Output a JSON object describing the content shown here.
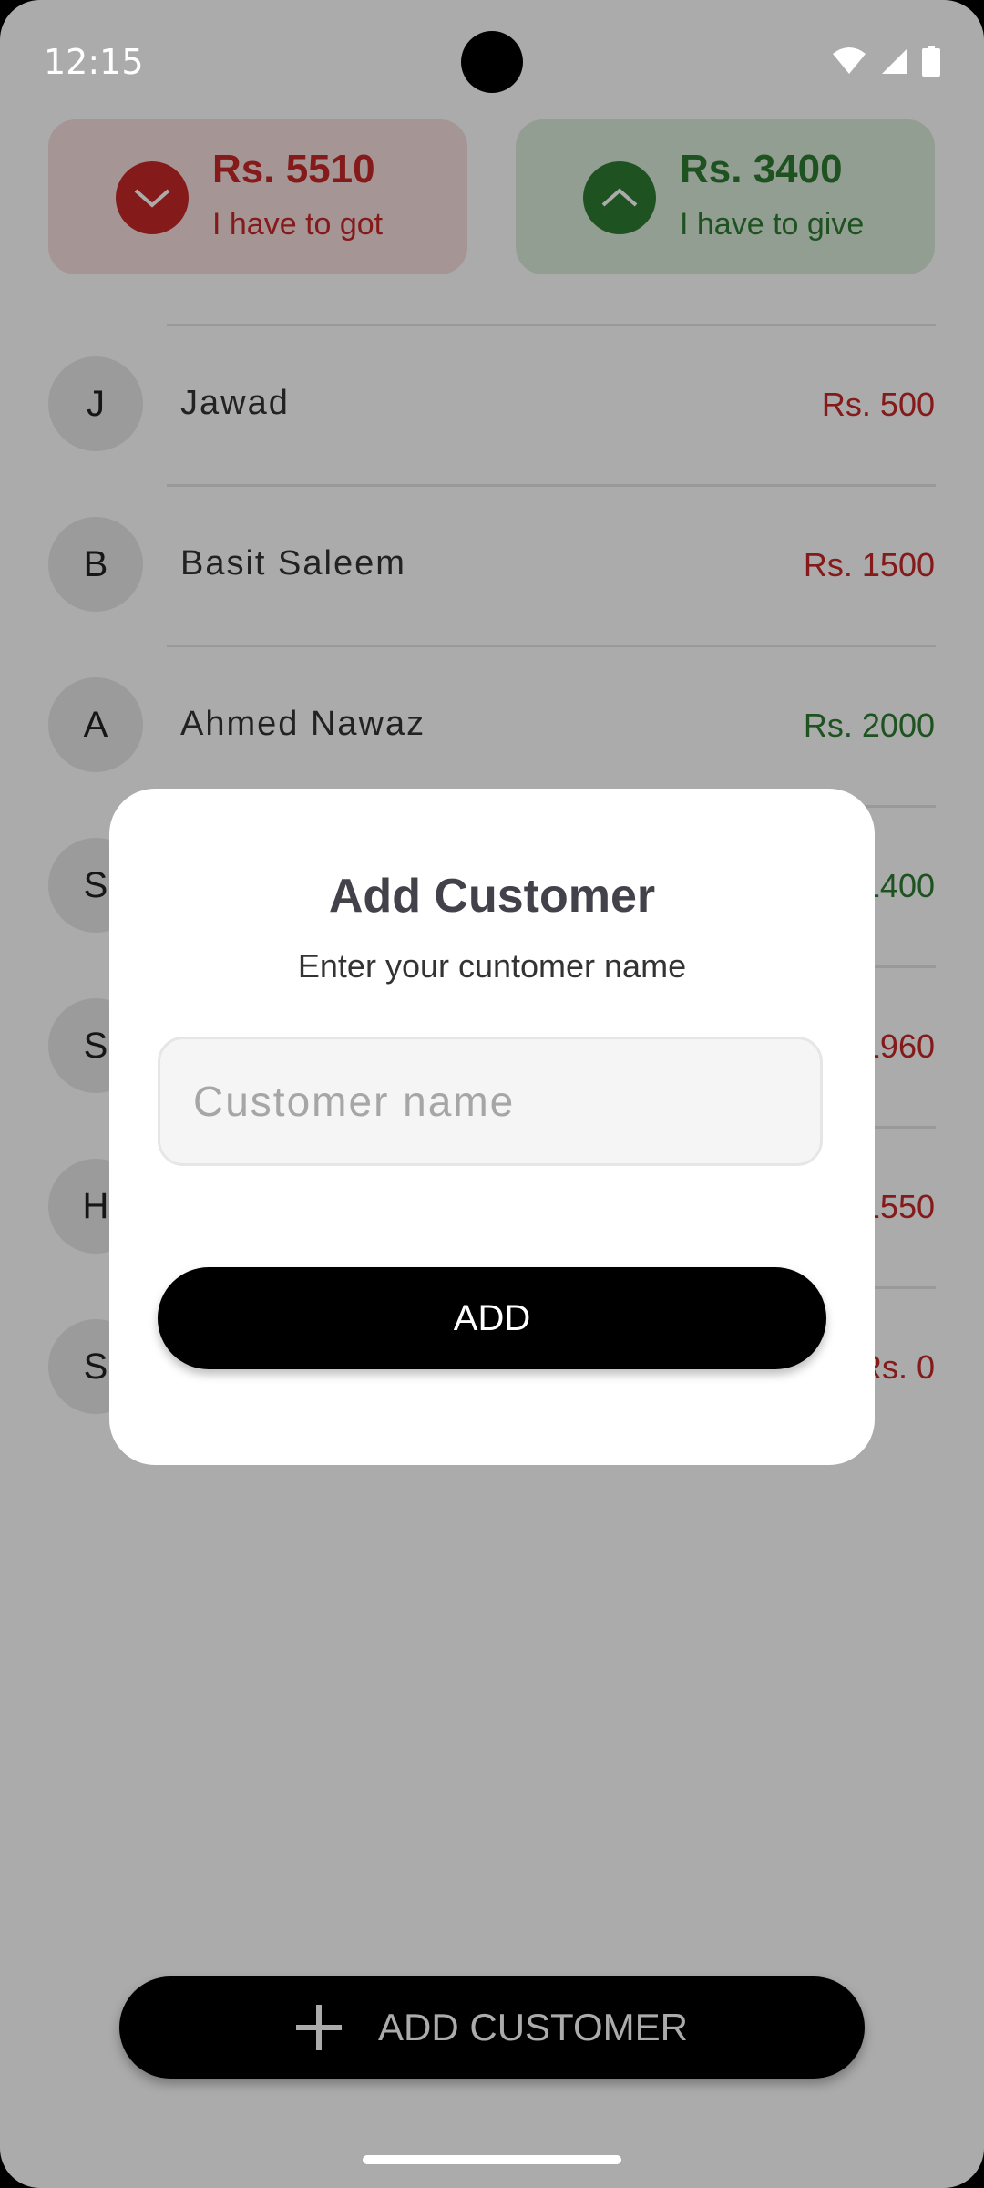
{
  "status_bar": {
    "time": "12:15"
  },
  "summary": {
    "got": {
      "amount": "Rs. 5510",
      "label": "I have to got",
      "color": "#c62828"
    },
    "give": {
      "amount": "Rs. 3400",
      "label": "I have to give",
      "color": "#2e7d32"
    }
  },
  "customers": [
    {
      "initial": "J",
      "name": "Jawad",
      "amount": "Rs. 500",
      "status": "red"
    },
    {
      "initial": "B",
      "name": "Basit Saleem",
      "amount": "Rs. 1500",
      "status": "red"
    },
    {
      "initial": "A",
      "name": "Ahmed Nawaz",
      "amount": "Rs. 2000",
      "status": "green"
    },
    {
      "initial": "S",
      "name": "",
      "amount": "1400",
      "status": "green"
    },
    {
      "initial": "S",
      "name": "",
      "amount": "1960",
      "status": "red"
    },
    {
      "initial": "H",
      "name": "",
      "amount": "1550",
      "status": "red"
    },
    {
      "initial": "S",
      "name": "",
      "amount": "Rs. 0",
      "status": "red"
    }
  ],
  "fab": {
    "label": "ADD CUSTOMER"
  },
  "dialog": {
    "title": "Add Customer",
    "subtitle": "Enter your cuntomer name",
    "input_placeholder": "Customer name",
    "input_value": "",
    "button_label": "ADD"
  }
}
